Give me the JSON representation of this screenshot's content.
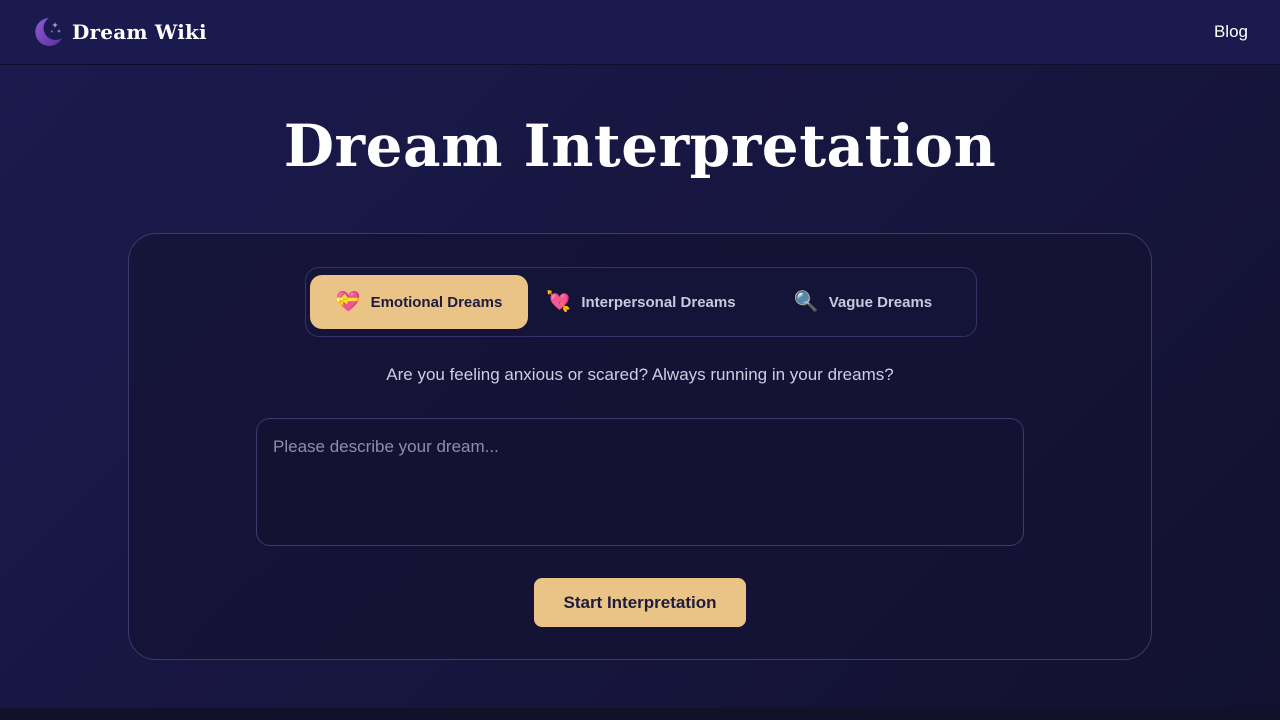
{
  "header": {
    "brand_name": "Dream Wiki",
    "brand_icon": "crescent-moon-sparkle-icon",
    "nav": {
      "blog_label": "Blog"
    }
  },
  "main": {
    "title": "Dream Interpretation",
    "tabs": [
      {
        "label": "Emotional Dreams",
        "icon": "💝",
        "icon_name": "heart-gift-icon",
        "active": true
      },
      {
        "label": "Interpersonal Dreams",
        "icon": "💘",
        "icon_name": "heart-arrow-icon",
        "active": false
      },
      {
        "label": "Vague Dreams",
        "icon": "🔍",
        "icon_name": "magnifier-icon",
        "active": false
      }
    ],
    "prompt": "Are you feeling anxious or scared? Always running in your dreams?",
    "dream_input": {
      "placeholder": "Please describe your dream...",
      "value": ""
    },
    "start_button_label": "Start Interpretation"
  },
  "colors": {
    "accent": "#e9c486",
    "background": "#1b1a4f",
    "card_border": "#3b3a6a",
    "text_muted": "#cfcde3"
  }
}
